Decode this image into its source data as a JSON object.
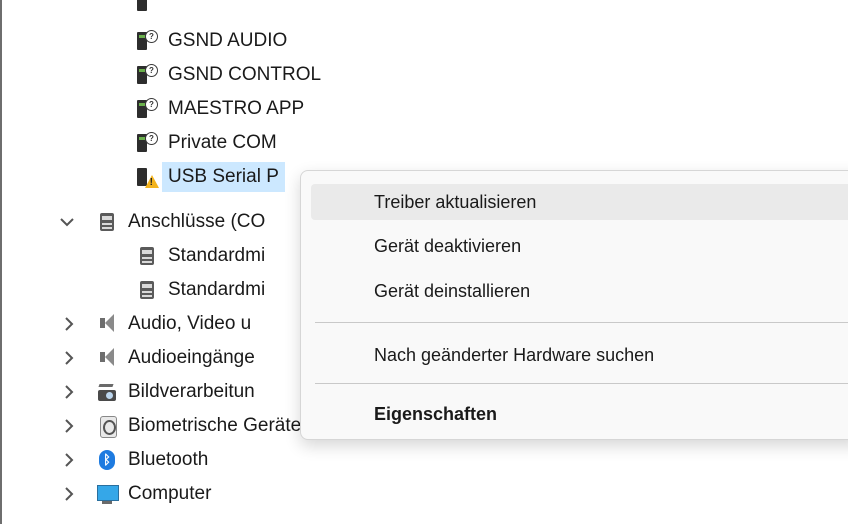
{
  "tree": {
    "child_items": [
      {
        "label": "GSND AUDIO",
        "icon": "unknown-device-icon"
      },
      {
        "label": "GSND CONTROL",
        "icon": "unknown-device-icon"
      },
      {
        "label": "MAESTRO APP",
        "icon": "unknown-device-icon"
      },
      {
        "label": "Private COM",
        "icon": "unknown-device-icon"
      },
      {
        "label": "USB Serial P",
        "icon": "warning-device-icon"
      }
    ],
    "ports": {
      "label": "Anschlüsse (CO",
      "children": [
        "Standardmi",
        "Standardmi"
      ]
    },
    "categories": [
      {
        "label": "Audio, Video u",
        "icon": "speaker-icon"
      },
      {
        "label": "Audioeingänge",
        "icon": "speaker-icon"
      },
      {
        "label": "Bildverarbeitun",
        "icon": "camera-icon"
      },
      {
        "label": "Biometrische Geräte",
        "icon": "fingerprint-icon"
      },
      {
        "label": "Bluetooth",
        "icon": "bluetooth-icon"
      },
      {
        "label": "Computer",
        "icon": "monitor-icon"
      }
    ]
  },
  "context_menu": {
    "update_driver": "Treiber aktualisieren",
    "disable_device": "Gerät deaktivieren",
    "uninstall_device": "Gerät deinstallieren",
    "scan_hardware": "Nach geänderter Hardware suchen",
    "properties": "Eigenschaften"
  },
  "colors": {
    "selection": "#cce8ff",
    "menu_background": "#f9f9f9",
    "menu_hover": "#eaeaea",
    "warning": "#f3b31c",
    "bluetooth": "#1e7be0"
  }
}
